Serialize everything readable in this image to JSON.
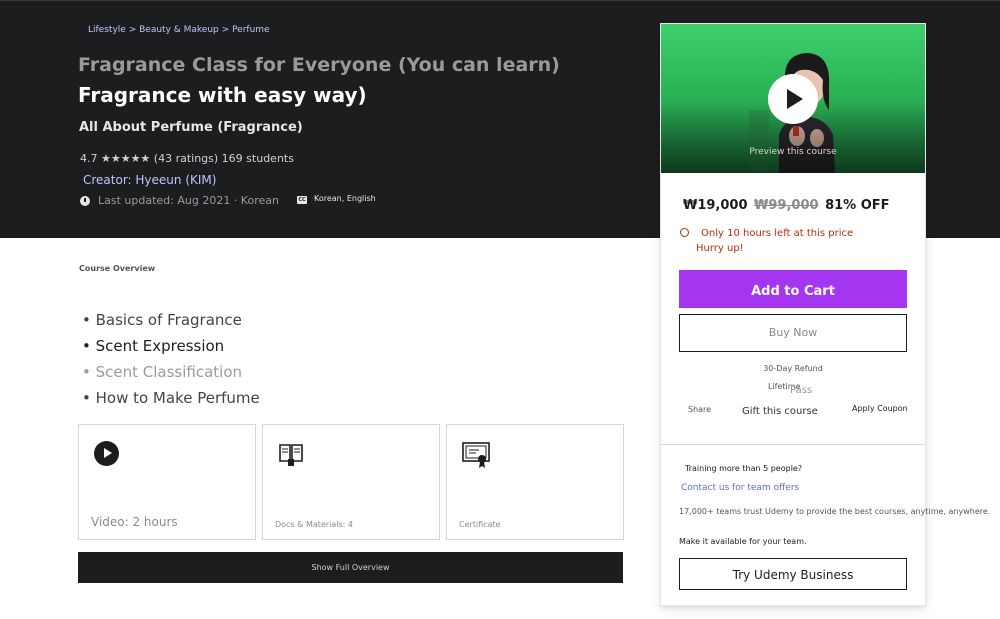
{
  "breadcrumb": {
    "items": [
      "Lifestyle",
      "Beauty & Makeup",
      "Perfume"
    ],
    "separator": ">"
  },
  "course": {
    "title_line1": "Fragrance Class for Everyone (You can learn)",
    "title_line2": "Fragrance with easy way)",
    "subtitle": "All About Perfume (Fragrance)",
    "rating_line": "4.7 ★★★★★ (43 ratings) 169 students",
    "creator": "Creator: Hyeeun (KIM)",
    "last_updated": "Last updated: Aug 2021 · Korean",
    "captions": "Korean, English",
    "caption_badge": "CC"
  },
  "overview": {
    "label": "Course Overview",
    "bullets": [
      "• Basics of Fragrance",
      "• Scent Expression",
      "• Scent Classification",
      "• How to Make Perfume"
    ],
    "cards": [
      {
        "caption": "Video: 2 hours",
        "icon": "play-circle-icon"
      },
      {
        "caption": "Docs & Materials: 4",
        "icon": "open-book-icon"
      },
      {
        "caption": "Certificate",
        "icon": "certificate-icon"
      }
    ],
    "show_full_label": "Show Full Overview"
  },
  "sidebar": {
    "preview_label": "Preview this course",
    "price": "₩19,000",
    "original_price": "₩99,000",
    "discount": "81% OFF",
    "urgency": "Only 10 hours left at this price",
    "hurry": "Hurry up!",
    "add_to_cart": "Add to Cart",
    "buy_now": "Buy Now",
    "refund": "30-Day Refund",
    "lifetime": "Lifetime",
    "pass": "Pass",
    "share": "Share",
    "gift": "Gift this course",
    "apply_coupon": "Apply Coupon",
    "team_question": "Training more than 5 people?",
    "team_link": "Contact us for team offers",
    "trust": "17,000+ teams trust Udemy to provide the best courses, anytime, anywhere.",
    "make_available": "Make it available for your team.",
    "try_business": "Try Udemy Business"
  },
  "colors": {
    "hero_bg": "#1c1d1f",
    "accent_purple": "#a435f0",
    "urgent_red": "#b32d0f",
    "link_blue": "#c0c4fc"
  }
}
